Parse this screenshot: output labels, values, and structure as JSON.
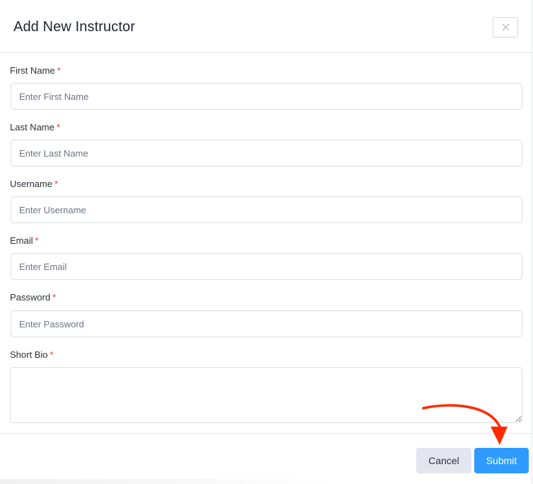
{
  "dialog": {
    "title": "Add New Instructor",
    "close_icon": "close-icon"
  },
  "fields": [
    {
      "label": "First Name",
      "required_mark": "*",
      "placeholder": "Enter First Name"
    },
    {
      "label": "Last Name",
      "required_mark": "*",
      "placeholder": "Enter Last Name"
    },
    {
      "label": "Username",
      "required_mark": "*",
      "placeholder": "Enter Username"
    },
    {
      "label": "Email",
      "required_mark": "*",
      "placeholder": "Enter Email"
    },
    {
      "label": "Password",
      "required_mark": "*",
      "placeholder": "Enter Password"
    },
    {
      "label": "Short Bio",
      "required_mark": "*",
      "placeholder": ""
    }
  ],
  "footer": {
    "cancel_label": "Cancel",
    "submit_label": "Submit"
  },
  "colors": {
    "primary": "#2f9bff",
    "required": "#e53935",
    "annotation": "#ff2a00"
  }
}
